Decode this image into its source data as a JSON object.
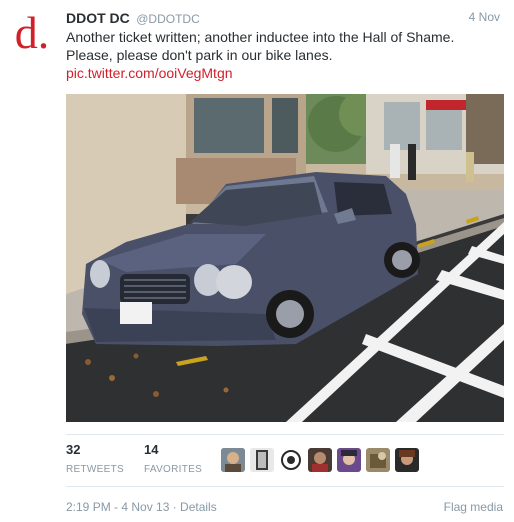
{
  "account": {
    "avatar_letter": "d.",
    "full_name": "DDOT DC",
    "screen_name": "@DDOTDC",
    "brand_color": "#d0202c"
  },
  "tweet": {
    "date": "4 Nov",
    "text_line_1": "Another ticket written; another inductee into the Hall of Shame.",
    "text_line_2": "Please, please don't park in our bike lanes.",
    "media_link": "pic.twitter.com/ooiVegMtgn"
  },
  "stats": {
    "retweets_count": "32",
    "retweets_label": "RETWEETS",
    "favorites_count": "14",
    "favorites_label": "FAVORITES"
  },
  "favoriters": [
    "user-avatar",
    "user-avatar",
    "user-avatar",
    "user-avatar",
    "user-avatar",
    "user-avatar",
    "user-avatar",
    "user-avatar"
  ],
  "footer": {
    "timestamp": "2:19 PM - 4 Nov 13 · Details",
    "flag_media": "Flag media"
  },
  "colors": {
    "text_primary": "#292f33",
    "text_secondary": "#8899a6",
    "divider": "#e1e8ed"
  }
}
